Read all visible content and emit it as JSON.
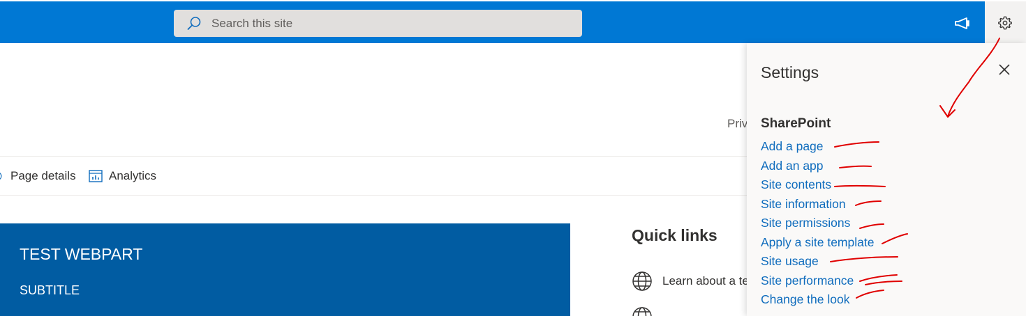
{
  "topbar": {
    "search_placeholder": "Search this site",
    "icons": [
      "search-icon",
      "megaphone-icon",
      "gear-icon"
    ],
    "accent": "#0078d4"
  },
  "page": {
    "partial_text": "Priv",
    "commands": [
      {
        "label": "Page details",
        "icon": "gear-icon"
      },
      {
        "label": "Analytics",
        "icon": "chart-icon"
      }
    ],
    "hero": {
      "title": "TEST WEBPART",
      "subtitle": "SUBTITLE",
      "color": "#015ca2"
    },
    "quick_links": {
      "title": "Quick links",
      "items": [
        {
          "label": "Learn about a te",
          "icon": "globe-icon"
        }
      ]
    }
  },
  "settings": {
    "title": "Settings",
    "section": "SharePoint",
    "links": [
      "Add a page",
      "Add an app",
      "Site contents",
      "Site information",
      "Site permissions",
      "Apply a site template",
      "Site usage",
      "Site performance",
      "Change the look"
    ],
    "link_color": "#0f6cbd",
    "annotation_color": "#e00000"
  }
}
